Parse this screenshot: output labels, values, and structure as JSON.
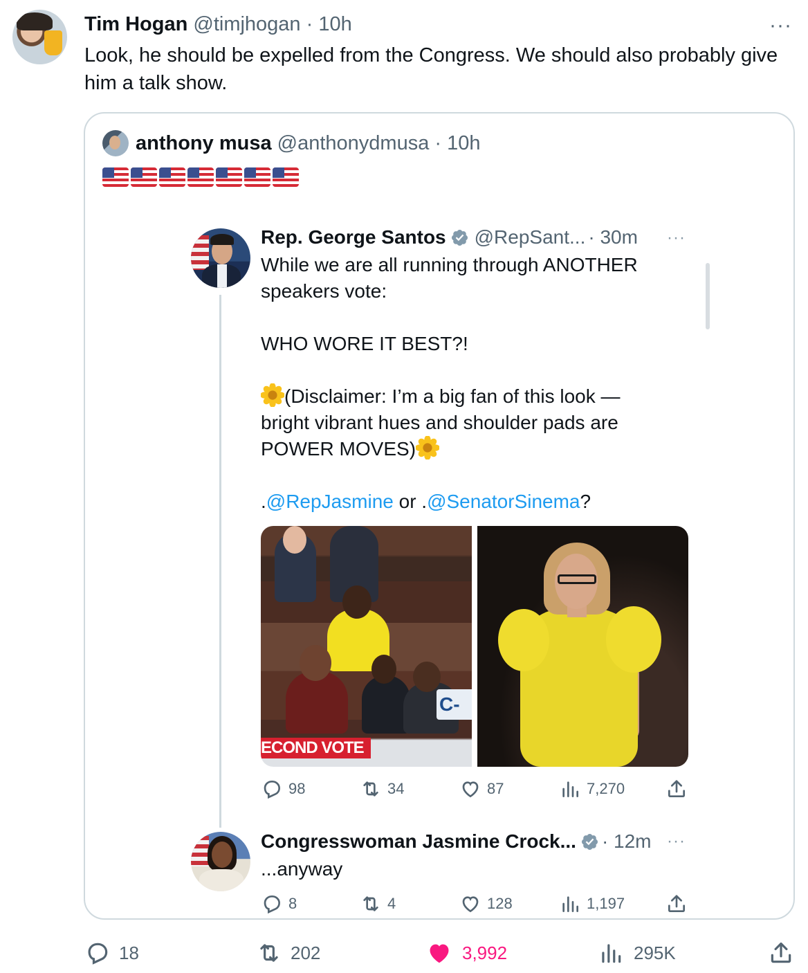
{
  "outer_tweet": {
    "author_name": "Tim Hogan",
    "author_handle": "@timjhogan",
    "time": "· 10h",
    "more": "···",
    "text": "Look, he should be expelled from the Congress. We should also probably give him a talk show.",
    "stats": {
      "replies": "18",
      "retweets": "202",
      "likes": "3,992",
      "views": "295K"
    },
    "liked": true,
    "like_color": "#f91880"
  },
  "quoted_tweet": {
    "author_name": "anthony musa",
    "author_handle": "@anthonydmusa",
    "time": "· 10h",
    "flag_count": 7,
    "flag_icon": "us-flag-emoji"
  },
  "santos_tweet": {
    "author_name": "Rep. George Santos",
    "author_handle": "@RepSant...",
    "time": "· 30m",
    "more": "···",
    "line1": "While we are all running through ANOTHER",
    "line2": "speakers vote:",
    "line3": "WHO WORE IT BEST?!",
    "line4": "(Disclaimer: I’m a big fan of this look —",
    "line5": "bright vibrant hues and shoulder pads are",
    "line6": "POWER MOVES)",
    "mention_prefix1": ".",
    "mention1": "@RepJasmine",
    "mention_mid": " or .",
    "mention2": "@SenatorSinema",
    "mention_suffix": "?",
    "media_left_banner": "ECOND VOTE",
    "media_left_logo": "C-",
    "stats": {
      "replies": "98",
      "retweets": "34",
      "likes": "87",
      "views": "7,270"
    }
  },
  "jasmine_reply": {
    "author_name": "Congresswoman Jasmine Crock...",
    "time": "· 12m",
    "more": "···",
    "text": "...anyway",
    "stats": {
      "replies": "8",
      "retweets": "4",
      "likes": "128",
      "views": "1,197"
    }
  },
  "colors": {
    "text": "#0f1419",
    "secondary": "#536471",
    "link": "#1d9bf0",
    "border": "#cfd9de",
    "verified": "#829aab"
  }
}
